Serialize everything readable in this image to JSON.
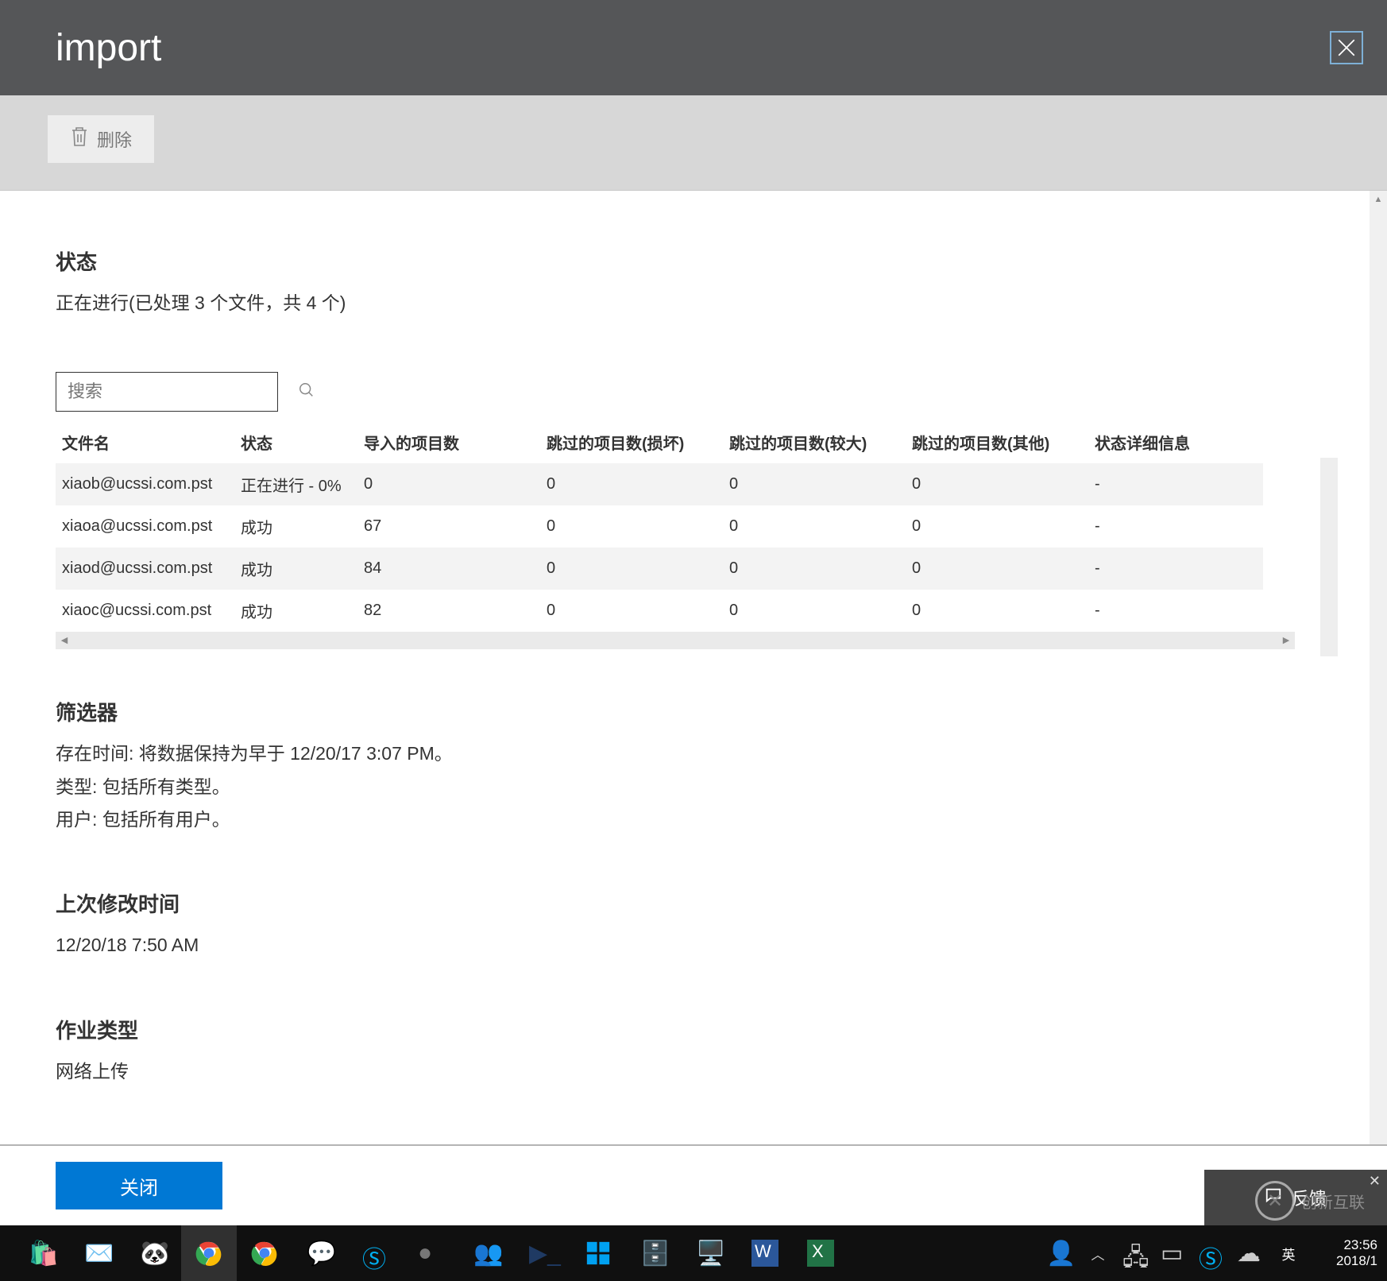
{
  "title": "import",
  "toolbar": {
    "delete_label": "删除"
  },
  "status": {
    "heading": "状态",
    "text": "正在进行(已处理 3 个文件，共 4 个)"
  },
  "search": {
    "placeholder": "搜索"
  },
  "table": {
    "headers": [
      "文件名",
      "状态",
      "导入的项目数",
      "跳过的项目数(损坏)",
      "跳过的项目数(较大)",
      "跳过的项目数(其他)",
      "状态详细信息"
    ],
    "rows": [
      {
        "file": "xiaob@ucssi.com.pst",
        "status": "正在进行 - 0%",
        "imported": "0",
        "bad": "0",
        "large": "0",
        "other": "0",
        "detail": "-"
      },
      {
        "file": "xiaoa@ucssi.com.pst",
        "status": "成功",
        "imported": "67",
        "bad": "0",
        "large": "0",
        "other": "0",
        "detail": "-"
      },
      {
        "file": "xiaod@ucssi.com.pst",
        "status": "成功",
        "imported": "84",
        "bad": "0",
        "large": "0",
        "other": "0",
        "detail": "-"
      },
      {
        "file": "xiaoc@ucssi.com.pst",
        "status": "成功",
        "imported": "82",
        "bad": "0",
        "large": "0",
        "other": "0",
        "detail": "-"
      }
    ]
  },
  "filter": {
    "heading": "筛选器",
    "line1": "存在时间: 将数据保持为早于 12/20/17 3:07 PM。",
    "line2": "类型: 包括所有类型。",
    "line3": "用户: 包括所有用户。"
  },
  "modified": {
    "heading": "上次修改时间",
    "value": "12/20/18 7:50 AM"
  },
  "jobtype": {
    "heading": "作业类型",
    "value": "网络上传"
  },
  "footer": {
    "close_label": "关闭"
  },
  "feedback": {
    "label": "反馈"
  },
  "tray": {
    "ime": "英",
    "time": "23:56",
    "date": "2018/1"
  },
  "watermark": "创新互联"
}
